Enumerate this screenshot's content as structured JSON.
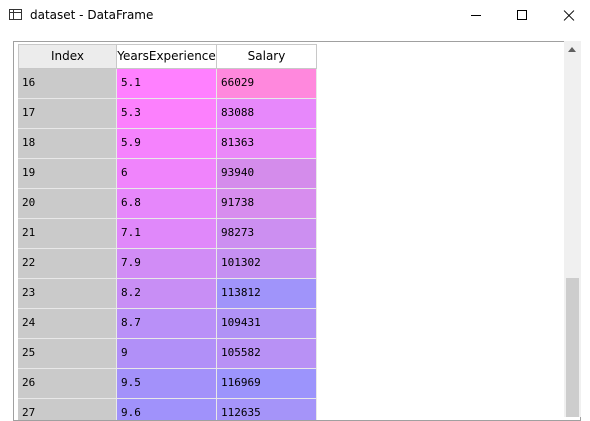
{
  "window": {
    "title": "dataset - DataFrame",
    "icon": "table-icon"
  },
  "table": {
    "headers": [
      "Index",
      "YearsExperience",
      "Salary"
    ],
    "rows": [
      {
        "index": "16",
        "years": "5.1",
        "salary": "66029",
        "years_color": "#ff80ff",
        "salary_color": "#ff88dd"
      },
      {
        "index": "17",
        "years": "5.3",
        "salary": "83088",
        "years_color": "#fc80fd",
        "salary_color": "#e788fb"
      },
      {
        "index": "18",
        "years": "5.9",
        "salary": "81363",
        "years_color": "#f582fd",
        "salary_color": "#ea88f8"
      },
      {
        "index": "19",
        "years": "6",
        "salary": "93940",
        "years_color": "#f084fc",
        "salary_color": "#d48ceb"
      },
      {
        "index": "20",
        "years": "6.8",
        "salary": "91738",
        "years_color": "#e687fb",
        "salary_color": "#d78dee"
      },
      {
        "index": "21",
        "years": "7.1",
        "salary": "98273",
        "years_color": "#e088fa",
        "salary_color": "#cc8ff1"
      },
      {
        "index": "22",
        "years": "7.9",
        "salary": "101302",
        "years_color": "#d18cf6",
        "salary_color": "#c590f2"
      },
      {
        "index": "23",
        "years": "8.2",
        "salary": "113812",
        "years_color": "#c88ef5",
        "salary_color": "#a094fa"
      },
      {
        "index": "24",
        "years": "8.7",
        "salary": "109431",
        "years_color": "#b990f8",
        "salary_color": "#b092f6"
      },
      {
        "index": "25",
        "years": "9",
        "salary": "105582",
        "years_color": "#b190f8",
        "salary_color": "#b891f5"
      },
      {
        "index": "26",
        "years": "9.5",
        "salary": "116969",
        "years_color": "#a391fa",
        "salary_color": "#9c94fc"
      },
      {
        "index": "27",
        "years": "9.6",
        "salary": "112635",
        "years_color": "#a092fb",
        "salary_color": "#a594f9"
      }
    ]
  },
  "scrollbar": {
    "position_fraction": 0.63
  }
}
